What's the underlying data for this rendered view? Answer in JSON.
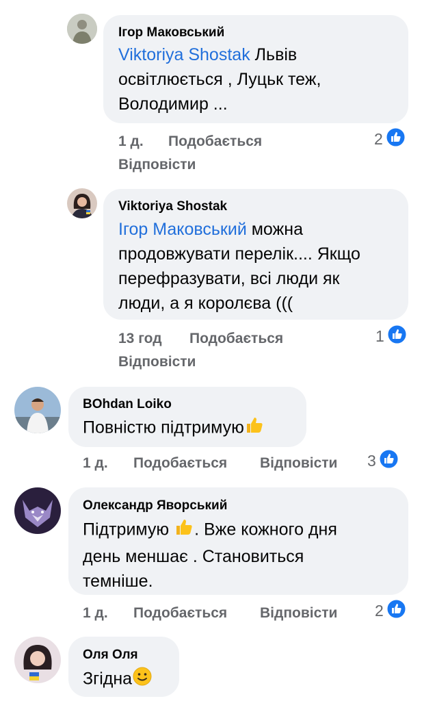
{
  "comments": [
    {
      "author": "Ігор Маковський",
      "mention": "Viktoriya  Shostak",
      "text_line1": " Львів",
      "text_line2": "освітлюється , Луцьк теж,",
      "text_line3": "Володимир ...",
      "time": "1 д.",
      "like_label": "Подобається",
      "reply_label": "Відповісти",
      "reaction_count": "2"
    },
    {
      "author": "Viktoriya  Shostak",
      "mention": "Ігор Маковський",
      "text_line1": " можна",
      "text_line2": "продовжувати перелік.... Якщо",
      "text_line3": "перефразувати, всі люди як",
      "text_line4": "люди, а я королєва (((",
      "time": "13 год",
      "like_label": "Подобається",
      "reply_label": "Відповісти",
      "reaction_count": "1"
    },
    {
      "author": "BOhdan Loiko",
      "text_line1": "Повністю підтримую",
      "time": "1 д.",
      "like_label": "Подобається",
      "reply_label": "Відповісти",
      "reaction_count": "3"
    },
    {
      "author": "Олександр Яворський",
      "text_line1a": "Підтримую ",
      "text_line1b": ". Вже кожного дня",
      "text_line2": "день меншає . Становиться",
      "text_line3": "темніше.",
      "time": "1 д.",
      "like_label": "Подобається",
      "reply_label": "Відповісти",
      "reaction_count": "2"
    },
    {
      "author": "Оля Оля",
      "text_line1": "Згідна"
    }
  ],
  "colors": {
    "bubble": "#f0f2f5",
    "link": "#216fdb",
    "meta": "#65676b",
    "like": "#1877f2"
  }
}
